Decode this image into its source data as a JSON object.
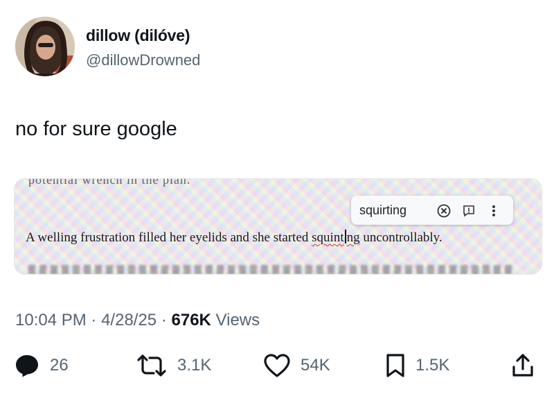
{
  "author": {
    "display_name": "dillow (dilóve)",
    "handle": "@dillowDrowned"
  },
  "tweet": {
    "text": "no for sure google"
  },
  "media": {
    "doc_text_top": "potential wrench in the plan.",
    "doc_sentence_before": "A welling frustration filled her eyelids and she started ",
    "doc_misspelled_a": "squint",
    "doc_misspelled_b": "ng",
    "doc_sentence_after": " uncontrollably.",
    "suggestion": {
      "word": "squirting",
      "icons": [
        "dismiss-x-icon",
        "feedback-icon",
        "more-vertical-icon"
      ]
    }
  },
  "meta": {
    "time": "10:04 PM",
    "sep1": "·",
    "date": "4/28/25",
    "sep2": "·",
    "views_count": "676K",
    "views_label": "Views"
  },
  "actions": {
    "replies": "26",
    "reposts": "3.1K",
    "likes": "54K",
    "bookmarks": "1.5K",
    "icons": [
      "reply-icon",
      "repost-icon",
      "like-icon",
      "bookmark-icon",
      "share-icon"
    ]
  },
  "colors": {
    "text": "#0f1419",
    "secondary": "#536471",
    "spell_underline": "#d93025"
  }
}
